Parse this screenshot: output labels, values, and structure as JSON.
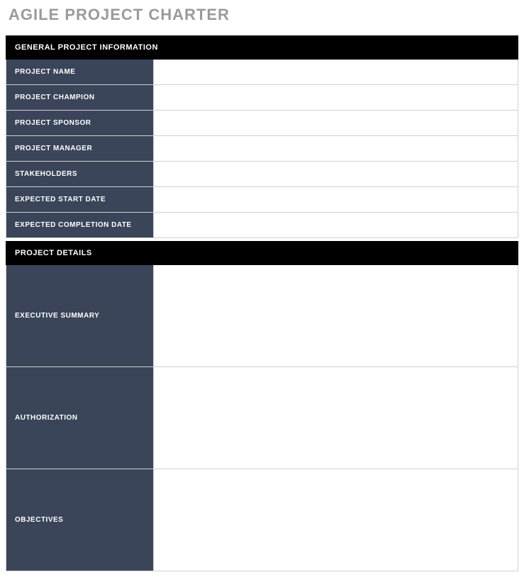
{
  "title": "AGILE PROJECT CHARTER",
  "sections": {
    "general": {
      "header": "GENERAL PROJECT INFORMATION",
      "rows": {
        "project_name": {
          "label": "PROJECT NAME",
          "value": ""
        },
        "project_champion": {
          "label": "PROJECT CHAMPION",
          "value": ""
        },
        "project_sponsor": {
          "label": "PROJECT SPONSOR",
          "value": ""
        },
        "project_manager": {
          "label": "PROJECT MANAGER",
          "value": ""
        },
        "stakeholders": {
          "label": "STAKEHOLDERS",
          "value": ""
        },
        "expected_start": {
          "label": "EXPECTED START DATE",
          "value": ""
        },
        "expected_completion": {
          "label": "EXPECTED COMPLETION DATE",
          "value": ""
        }
      }
    },
    "details": {
      "header": "PROJECT DETAILS",
      "rows": {
        "executive_summary": {
          "label": "EXECUTIVE SUMMARY",
          "value": ""
        },
        "authorization": {
          "label": "AUTHORIZATION",
          "value": ""
        },
        "objectives": {
          "label": "OBJECTIVES",
          "value": ""
        }
      }
    }
  }
}
